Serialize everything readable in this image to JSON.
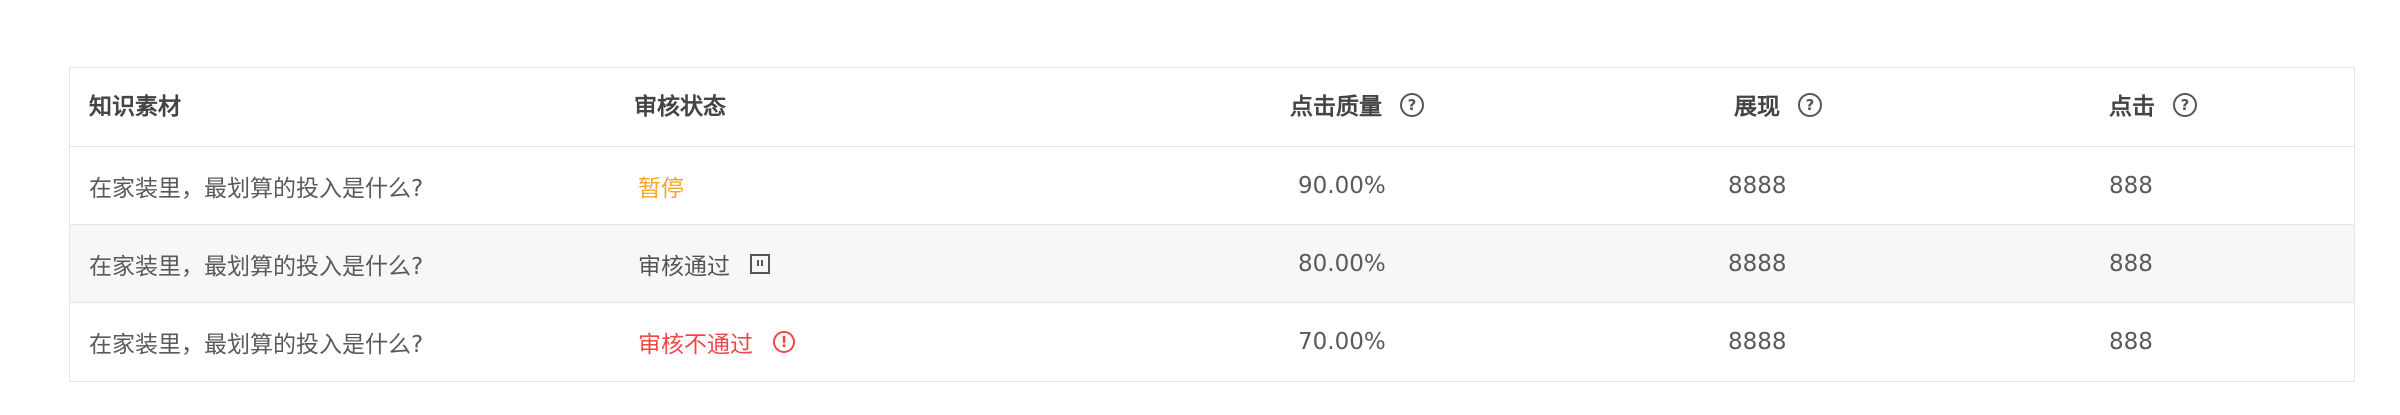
{
  "table": {
    "columns": {
      "material": "知识素材",
      "status": "审核状态",
      "quality": "点击质量",
      "impressions": "展现",
      "clicks": "点击"
    },
    "help_glyph": "?",
    "rows": [
      {
        "material": "在家装里，最划算的投入是什么?",
        "status": "暂停",
        "status_type": "paused",
        "quality": "90.00%",
        "impressions": "8888",
        "clicks": "888"
      },
      {
        "material": "在家装里，最划算的投入是什么?",
        "status": "审核通过",
        "status_type": "passed",
        "quality": "80.00%",
        "impressions": "8888",
        "clicks": "888"
      },
      {
        "material": "在家装里，最划算的投入是什么?",
        "status": "审核不通过",
        "status_type": "failed",
        "quality": "70.00%",
        "impressions": "8888",
        "clicks": "888"
      }
    ],
    "alert_glyph": "!"
  },
  "colors": {
    "paused": "#f5a623",
    "failed": "#f04848",
    "border": "#e6e6e6",
    "shaded_row": "#f7f7f7"
  }
}
